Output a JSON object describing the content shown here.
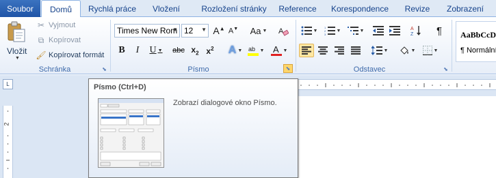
{
  "tabs": {
    "file": "Soubor",
    "items": [
      {
        "label": "Domů",
        "active": true
      },
      {
        "label": "Rychlá práce"
      },
      {
        "label": "Vložení"
      },
      {
        "label": "Rozložení stránky"
      },
      {
        "label": "Reference"
      },
      {
        "label": "Korespondence"
      },
      {
        "label": "Revize"
      },
      {
        "label": "Zobrazení"
      }
    ]
  },
  "clipboard": {
    "paste": "Vložit",
    "cut": "Vyjmout",
    "copy": "Kopírovat",
    "format_painter": "Kopírovat formát",
    "group_label": "Schránka"
  },
  "font": {
    "name": "Times New Rom",
    "size": "12",
    "group_label": "Písmo"
  },
  "paragraph": {
    "group_label": "Odstavec"
  },
  "styles": {
    "sample": "AaBbCcD",
    "normal": "¶ Normální"
  },
  "ruler": {
    "vertical_number": "2"
  },
  "tooltip": {
    "title": "Písmo (Ctrl+D)",
    "description": "Zobrazí dialogové okno Písmo."
  },
  "colors": {
    "accent": "#1f54a7",
    "highlight": "#ffe7a2",
    "font_color": "#e02020",
    "highlight_color": "#ffff00"
  }
}
